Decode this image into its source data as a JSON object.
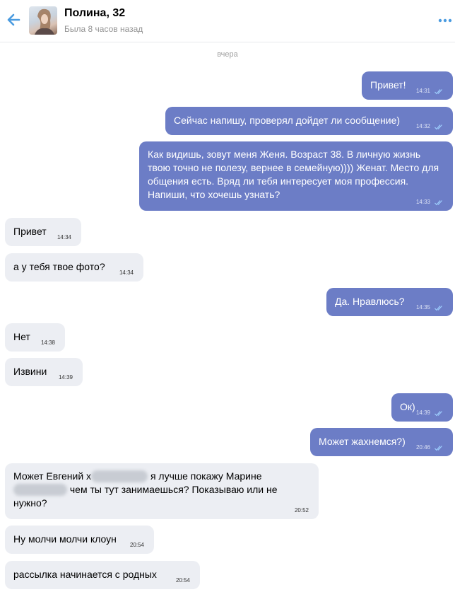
{
  "header": {
    "title": "Полина, 32",
    "status": "Была 8 часов назад"
  },
  "day_separator": "вчера",
  "messages": [
    {
      "dir": "out",
      "text": "Привет!",
      "time": "14:31"
    },
    {
      "dir": "out",
      "text": "Сейчас напишу, проверял дойдет ли сообщение)",
      "time": "14:32"
    },
    {
      "dir": "out",
      "text": "Как видишь, зовут меня Женя. Возраст 38. В личную жизнь твою точно не полезу, вернее в семейную)))) Женат. Место для общения есть. Вряд ли тебя интересует моя профессия. Напиши, что хочешь узнать?",
      "time": "14:33"
    },
    {
      "dir": "in",
      "text": "Привет",
      "time": "14:34"
    },
    {
      "dir": "in",
      "text": "а у тебя твое фото?",
      "time": "14:34"
    },
    {
      "dir": "out",
      "text": "Да. Нравлюсь?",
      "time": "14:35"
    },
    {
      "dir": "in",
      "text": "Нет",
      "time": "14:38"
    },
    {
      "dir": "in",
      "text": "Извини",
      "time": "14:39"
    },
    {
      "dir": "out",
      "text": "Ок)",
      "time": "14:39"
    },
    {
      "dir": "out",
      "text": "Может жахнемся?)",
      "time": "20:46"
    },
    {
      "dir": "in",
      "text_parts": [
        "Может Евгений х",
        "я лучше покажу Марине",
        "чем ты тут занимаешься? Показываю или не нужно?"
      ],
      "time": "20:52"
    },
    {
      "dir": "in",
      "text": "Ну молчи молчи клоун",
      "time": "20:54"
    },
    {
      "dir": "in",
      "text": "рассылка начинается с родных",
      "time": "20:54"
    }
  ]
}
